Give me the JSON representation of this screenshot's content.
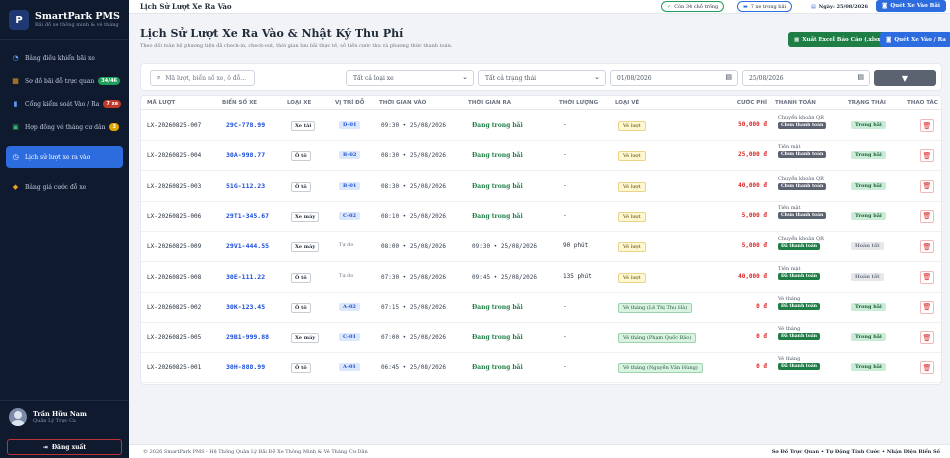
{
  "sidebar": {
    "brand_name": "SmartPark PMS",
    "brand_sub": "Bãi đỗ xe thông minh & vé tháng",
    "brand_logo": "P",
    "items": [
      {
        "label": "Bảng điều khiển bãi xe",
        "icon": "dashboard-icon",
        "glyph": "◔",
        "color": "#5aa0ff"
      },
      {
        "label": "Sơ đồ bãi đỗ trực quan",
        "icon": "map-icon",
        "glyph": "▦",
        "color": "#f0a020",
        "badge": "34/46",
        "badge_color": "#1e9e5a"
      },
      {
        "label": "Cổng kiểm soát Vào / Ra",
        "icon": "gate-icon",
        "glyph": "▮",
        "color": "#5aa0ff",
        "badge": "7 xe",
        "badge_color": "#c0392b"
      },
      {
        "label": "Hợp đồng vé tháng cư dân",
        "icon": "contract-icon",
        "glyph": "▣",
        "color": "#3cb371",
        "badge": "3",
        "badge_color": "#e0a400"
      },
      {
        "label": "Lịch sử lượt xe ra vào",
        "icon": "history-icon",
        "glyph": "◷",
        "color": "#ffffff"
      },
      {
        "label": "Bảng giá cước đỗ xe",
        "icon": "tag-icon",
        "glyph": "◆",
        "color": "#f0a020"
      }
    ],
    "user_name": "Trần Hữu Nam",
    "user_role": "Quản Lý Trực Ca",
    "logout": "Đăng xuất"
  },
  "topbar": {
    "title": "Lịch Sử Lượt Xe Ra Vào",
    "free_slots": "Còn 34 chỗ trống",
    "in_lot": "7 xe trong bãi",
    "date": "Ngày: 25/08/2026",
    "quick_in_out": "Quét Xe Vào Bãi"
  },
  "page": {
    "title": "Lịch Sử Lượt Xe Ra Vào & Nhật Ký Thu Phí",
    "desc": "Theo dõi toàn bộ phương tiện đã check-in, check-out, thời gian lưu bãi thực tế, số tiền cước thu và phương thức thanh toán.",
    "export": "Xuất Excel Báo Cáo (.xlsx)",
    "scan": "Quét Xe Vào / Ra"
  },
  "filters": {
    "search_placeholder": "Mã lượt, biển số xe, ô đỗ...",
    "vehicle_type": "Tất cả loại xe",
    "status": "Tất cả trạng thái",
    "date_from": "01/08/2026",
    "date_to": "25/08/2026"
  },
  "table": {
    "headers": [
      "MÃ LƯỢT",
      "BIỂN SỐ XE",
      "LOẠI XE",
      "VỊ TRÍ ĐỖ",
      "THỜI GIAN VÀO",
      "THỜI GIAN RA",
      "THỜI LƯỢNG",
      "LOẠI VÉ",
      "CƯỚC PHÍ",
      "THANH TOÁN",
      "TRẠNG THÁI",
      "THAO TÁC"
    ],
    "rows": [
      {
        "id": "LX-20260825-007",
        "plate": "29C-778.99",
        "type": "Xe tải",
        "spot": "D-01",
        "spot_style": "spot",
        "in": "09:30 • 25/08/2026",
        "out": "Đang trong bãi",
        "duration": "-",
        "ticket": "Vé lượt",
        "ticket_kind": "day",
        "fee": "50,000 đ",
        "pay_method": "Chuyển khoản QR",
        "pay_status": "Chưa thanh toán",
        "pay_ok": false,
        "state": "Trong bãi",
        "state_kind": "in"
      },
      {
        "id": "LX-20260825-004",
        "plate": "30A-998.77",
        "type": "Ô tô",
        "spot": "B-02",
        "spot_style": "spot",
        "in": "08:30 • 25/08/2026",
        "out": "Đang trong bãi",
        "duration": "-",
        "ticket": "Vé lượt",
        "ticket_kind": "day",
        "fee": "25,000 đ",
        "pay_method": "Tiền mặt",
        "pay_status": "Chưa thanh toán",
        "pay_ok": false,
        "state": "Trong bãi",
        "state_kind": "in"
      },
      {
        "id": "LX-20260825-003",
        "plate": "51G-112.23",
        "type": "Ô tô",
        "spot": "B-01",
        "spot_style": "spot",
        "in": "08:30 • 25/08/2026",
        "out": "Đang trong bãi",
        "duration": "-",
        "ticket": "Vé lượt",
        "ticket_kind": "day",
        "fee": "40,000 đ",
        "pay_method": "Chuyển khoản QR",
        "pay_status": "Chưa thanh toán",
        "pay_ok": false,
        "state": "Trong bãi",
        "state_kind": "in"
      },
      {
        "id": "LX-20260825-006",
        "plate": "29T1-345.67",
        "type": "Xe máy",
        "spot": "C-02",
        "spot_style": "spot",
        "in": "08:10 • 25/08/2026",
        "out": "Đang trong bãi",
        "duration": "-",
        "ticket": "Vé lượt",
        "ticket_kind": "day",
        "fee": "5,000 đ",
        "pay_method": "Tiền mặt",
        "pay_status": "Chưa thanh toán",
        "pay_ok": false,
        "state": "Trong bãi",
        "state_kind": "in"
      },
      {
        "id": "LX-20260825-009",
        "plate": "29V1-444.55",
        "type": "Xe máy",
        "spot": "Tự do",
        "spot_style": "free",
        "in": "08:00 • 25/08/2026",
        "out": "09:30 • 25/08/2026",
        "duration": "90 phút",
        "ticket": "Vé lượt",
        "ticket_kind": "day",
        "fee": "5,000 đ",
        "pay_method": "Chuyển khoản QR",
        "pay_status": "Đã thanh toán",
        "pay_ok": true,
        "state": "Hoàn tất",
        "state_kind": "done"
      },
      {
        "id": "LX-20260825-008",
        "plate": "30E-111.22",
        "type": "Ô tô",
        "spot": "Tự do",
        "spot_style": "free",
        "in": "07:30 • 25/08/2026",
        "out": "09:45 • 25/08/2026",
        "duration": "135 phút",
        "ticket": "Vé lượt",
        "ticket_kind": "day",
        "fee": "40,000 đ",
        "pay_method": "Tiền mặt",
        "pay_status": "Đã thanh toán",
        "pay_ok": true,
        "state": "Hoàn tất",
        "state_kind": "done"
      },
      {
        "id": "LX-20260825-002",
        "plate": "30K-123.45",
        "type": "Ô tô",
        "spot": "A-02",
        "spot_style": "spot",
        "in": "07:15 • 25/08/2026",
        "out": "Đang trong bãi",
        "duration": "-",
        "ticket": "Vé tháng (Lê Thị Thu Hà)",
        "ticket_kind": "month",
        "fee": "0 đ",
        "pay_method": "Vé tháng",
        "pay_status": "Đã thanh toán",
        "pay_ok": true,
        "state": "Trong bãi",
        "state_kind": "in"
      },
      {
        "id": "LX-20260825-005",
        "plate": "29B1-999.88",
        "type": "Xe máy",
        "spot": "C-01",
        "spot_style": "spot",
        "in": "07:00 • 25/08/2026",
        "out": "Đang trong bãi",
        "duration": "-",
        "ticket": "Vé tháng (Phạm Quốc Bảo)",
        "ticket_kind": "month",
        "fee": "0 đ",
        "pay_method": "Vé tháng",
        "pay_status": "Đã thanh toán",
        "pay_ok": true,
        "state": "Trong bãi",
        "state_kind": "in"
      },
      {
        "id": "LX-20260825-001",
        "plate": "30H-888.99",
        "type": "Ô tô",
        "spot": "A-01",
        "spot_style": "spot",
        "in": "06:45 • 25/08/2026",
        "out": "Đang trong bãi",
        "duration": "-",
        "ticket": "Vé tháng (Nguyễn Văn Hùng)",
        "ticket_kind": "month",
        "fee": "0 đ",
        "pay_method": "Vé tháng",
        "pay_status": "Đã thanh toán",
        "pay_ok": true,
        "state": "Trong bãi",
        "state_kind": "in"
      }
    ]
  },
  "footer": {
    "left": "© 2026 SmartPark PMS - Hệ Thống Quản Lý Bãi Đỗ Xe Thông Minh & Vé Tháng Cư Dân",
    "right": "Sơ Đồ Trực Quan • Tự Động Tính Cước • Nhận Diện Biển Số"
  }
}
